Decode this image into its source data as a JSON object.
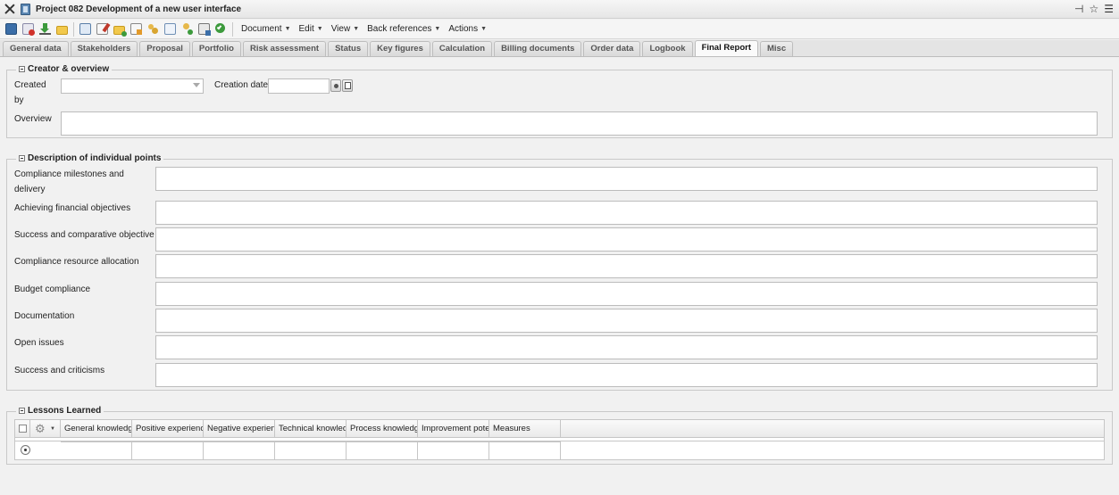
{
  "window": {
    "title": "Project 082 Development of a new user interface"
  },
  "toolbar": {
    "icons": [
      "save-icon",
      "delete-icon",
      "download-icon",
      "open-folder-icon",
      "form-icon",
      "edit-icon",
      "add-folder-icon",
      "edit-document-icon",
      "users-icon",
      "list-icon",
      "add-user-icon",
      "print-icon",
      "check-search-icon"
    ],
    "menus": [
      {
        "label": "Document"
      },
      {
        "label": "Edit"
      },
      {
        "label": "View"
      },
      {
        "label": "Back references"
      },
      {
        "label": "Actions"
      }
    ]
  },
  "tabs": [
    {
      "label": "General data"
    },
    {
      "label": "Stakeholders"
    },
    {
      "label": "Proposal"
    },
    {
      "label": "Portfolio"
    },
    {
      "label": "Risk assessment"
    },
    {
      "label": "Status"
    },
    {
      "label": "Key figures"
    },
    {
      "label": "Calculation"
    },
    {
      "label": "Billing documents"
    },
    {
      "label": "Order data"
    },
    {
      "label": "Logbook"
    },
    {
      "label": "Final Report",
      "active": true
    },
    {
      "label": "Misc"
    }
  ],
  "creator_overview": {
    "legend": "Creator & overview",
    "created_by_label_1": "Created",
    "created_by_label_2": "by",
    "created_by_value": "",
    "creation_date_label": "Creation date",
    "creation_date_value": "",
    "overview_label": "Overview",
    "overview_value": ""
  },
  "description": {
    "legend": "Description of individual points",
    "fields": [
      {
        "label_1": "Compliance milestones and",
        "label_2": "delivery",
        "value": ""
      },
      {
        "label_1": "Achieving financial objectives",
        "label_2": "",
        "value": ""
      },
      {
        "label_1": "Success and comparative objective",
        "label_2": "",
        "value": ""
      },
      {
        "label_1": "Compliance resource allocation",
        "label_2": "",
        "value": ""
      },
      {
        "label_1": "Budget compliance",
        "label_2": "",
        "value": ""
      },
      {
        "label_1": "Documentation",
        "label_2": "",
        "value": ""
      },
      {
        "label_1": "Open issues",
        "label_2": "",
        "value": ""
      },
      {
        "label_1": "Success and criticisms",
        "label_2": "",
        "value": ""
      }
    ]
  },
  "lessons": {
    "legend": "Lessons Learned",
    "columns": [
      "General knowledge",
      "Positive experience",
      "Negative experience",
      "Technical knowledge",
      "Process knowledge",
      "Improvement potential",
      "Measures"
    ]
  }
}
